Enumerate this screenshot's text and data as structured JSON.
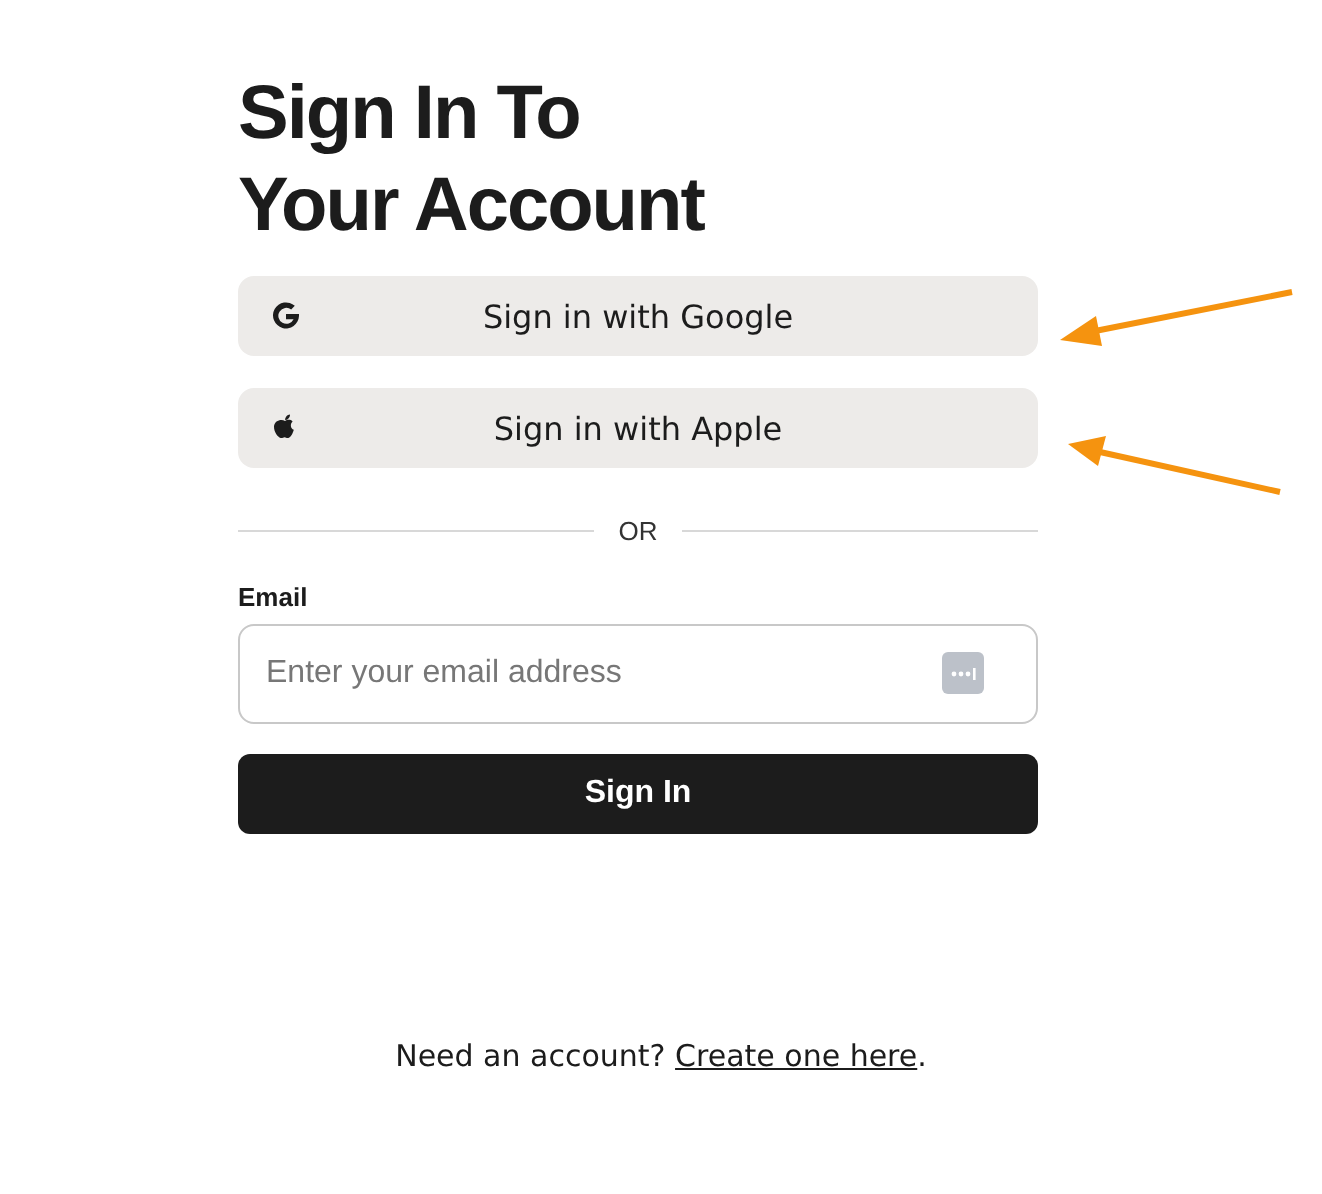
{
  "heading": [
    "Sign In To",
    "Your Account"
  ],
  "providers": [
    {
      "kind": "google",
      "label": "Sign in with Google"
    },
    {
      "kind": "apple",
      "label": "Sign in with Apple"
    }
  ],
  "divider": "OR",
  "email": {
    "label": "Email",
    "placeholder": "Enter your email address"
  },
  "submit": "Sign In",
  "footer": {
    "text": "Need an account?",
    "link": "Create one here",
    "suffix": "."
  }
}
